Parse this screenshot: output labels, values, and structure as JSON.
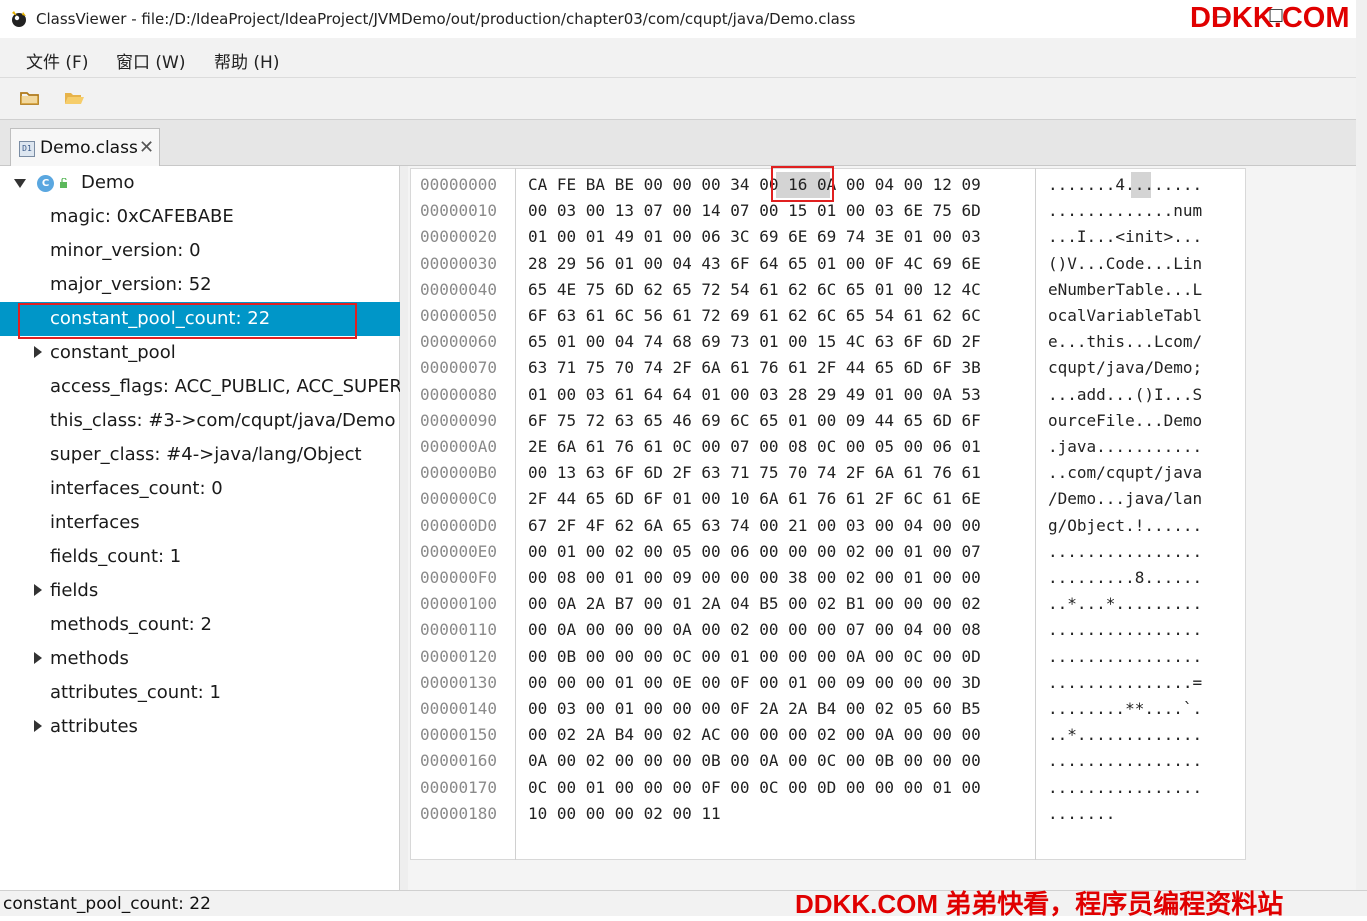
{
  "window": {
    "title": "ClassViewer - file:/D:/IdeaProject/IdeaProject/JVMDemo/out/production/chapter03/com/cqupt/java/Demo.class",
    "watermark_top": "DDKK.COM"
  },
  "menu": [
    {
      "label": "文件 (F)"
    },
    {
      "label": "窗口 (W)"
    },
    {
      "label": "帮助 (H)"
    }
  ],
  "toolbar": {
    "buttons": [
      {
        "icon": "folder-icon"
      },
      {
        "icon": "folder-open-icon"
      }
    ]
  },
  "tabs": [
    {
      "label": "Demo.class",
      "icon_text": "D1"
    }
  ],
  "tree": {
    "root": {
      "label": "Demo",
      "icon_letter": "C"
    },
    "items": [
      {
        "label": "magic: 0xCAFEBABE",
        "expandable": false
      },
      {
        "label": "minor_version: 0",
        "expandable": false
      },
      {
        "label": "major_version: 52",
        "expandable": false
      },
      {
        "label": "constant_pool_count: 22",
        "expandable": false,
        "selected": true
      },
      {
        "label": "constant_pool",
        "expandable": true
      },
      {
        "label": "access_flags: ACC_PUBLIC, ACC_SUPER",
        "expandable": false
      },
      {
        "label": "this_class: #3->com/cqupt/java/Demo",
        "expandable": false
      },
      {
        "label": "super_class: #4->java/lang/Object",
        "expandable": false
      },
      {
        "label": "interfaces_count: 0",
        "expandable": false
      },
      {
        "label": "interfaces",
        "expandable": false
      },
      {
        "label": "fields_count: 1",
        "expandable": false
      },
      {
        "label": "fields",
        "expandable": true
      },
      {
        "label": "methods_count: 2",
        "expandable": false
      },
      {
        "label": "methods",
        "expandable": true
      },
      {
        "label": "attributes_count: 1",
        "expandable": false
      },
      {
        "label": "attributes",
        "expandable": true
      }
    ]
  },
  "hex": {
    "rows": [
      {
        "offset": "00000000",
        "bytes": "CA FE BA BE 00 00 00 34 00 16 0A 00 04 00 12 09",
        "ascii": ".......4........"
      },
      {
        "offset": "00000010",
        "bytes": "00 03 00 13 07 00 14 07 00 15 01 00 03 6E 75 6D",
        "ascii": ".............num"
      },
      {
        "offset": "00000020",
        "bytes": "01 00 01 49 01 00 06 3C 69 6E 69 74 3E 01 00 03",
        "ascii": "...I...<init>..."
      },
      {
        "offset": "00000030",
        "bytes": "28 29 56 01 00 04 43 6F 64 65 01 00 0F 4C 69 6E",
        "ascii": "()V...Code...Lin"
      },
      {
        "offset": "00000040",
        "bytes": "65 4E 75 6D 62 65 72 54 61 62 6C 65 01 00 12 4C",
        "ascii": "eNumberTable...L"
      },
      {
        "offset": "00000050",
        "bytes": "6F 63 61 6C 56 61 72 69 61 62 6C 65 54 61 62 6C",
        "ascii": "ocalVariableTabl"
      },
      {
        "offset": "00000060",
        "bytes": "65 01 00 04 74 68 69 73 01 00 15 4C 63 6F 6D 2F",
        "ascii": "e...this...Lcom/"
      },
      {
        "offset": "00000070",
        "bytes": "63 71 75 70 74 2F 6A 61 76 61 2F 44 65 6D 6F 3B",
        "ascii": "cqupt/java/Demo;"
      },
      {
        "offset": "00000080",
        "bytes": "01 00 03 61 64 64 01 00 03 28 29 49 01 00 0A 53",
        "ascii": "...add...()I...S"
      },
      {
        "offset": "00000090",
        "bytes": "6F 75 72 63 65 46 69 6C 65 01 00 09 44 65 6D 6F",
        "ascii": "ourceFile...Demo"
      },
      {
        "offset": "000000A0",
        "bytes": "2E 6A 61 76 61 0C 00 07 00 08 0C 00 05 00 06 01",
        "ascii": ".java..........."
      },
      {
        "offset": "000000B0",
        "bytes": "00 13 63 6F 6D 2F 63 71 75 70 74 2F 6A 61 76 61",
        "ascii": "..com/cqupt/java"
      },
      {
        "offset": "000000C0",
        "bytes": "2F 44 65 6D 6F 01 00 10 6A 61 76 61 2F 6C 61 6E",
        "ascii": "/Demo...java/lan"
      },
      {
        "offset": "000000D0",
        "bytes": "67 2F 4F 62 6A 65 63 74 00 21 00 03 00 04 00 00",
        "ascii": "g/Object.!......"
      },
      {
        "offset": "000000E0",
        "bytes": "00 01 00 02 00 05 00 06 00 00 00 02 00 01 00 07",
        "ascii": "................"
      },
      {
        "offset": "000000F0",
        "bytes": "00 08 00 01 00 09 00 00 00 38 00 02 00 01 00 00",
        "ascii": ".........8......"
      },
      {
        "offset": "00000100",
        "bytes": "00 0A 2A B7 00 01 2A 04 B5 00 02 B1 00 00 00 02",
        "ascii": "..*...*........."
      },
      {
        "offset": "00000110",
        "bytes": "00 0A 00 00 00 0A 00 02 00 00 00 07 00 04 00 08",
        "ascii": "................"
      },
      {
        "offset": "00000120",
        "bytes": "00 0B 00 00 00 0C 00 01 00 00 00 0A 00 0C 00 0D",
        "ascii": "................"
      },
      {
        "offset": "00000130",
        "bytes": "00 00 00 01 00 0E 00 0F 00 01 00 09 00 00 00 3D",
        "ascii": "...............="
      },
      {
        "offset": "00000140",
        "bytes": "00 03 00 01 00 00 00 0F 2A 2A B4 00 02 05 60 B5",
        "ascii": "........**....`."
      },
      {
        "offset": "00000150",
        "bytes": "00 02 2A B4 00 02 AC 00 00 00 02 00 0A 00 00 00",
        "ascii": "..*............."
      },
      {
        "offset": "00000160",
        "bytes": "0A 00 02 00 00 00 0B 00 0A 00 0C 00 0B 00 00 00",
        "ascii": "................"
      },
      {
        "offset": "00000170",
        "bytes": "0C 00 01 00 00 00 0F 00 0C 00 0D 00 00 00 01 00",
        "ascii": "................"
      },
      {
        "offset": "00000180",
        "bytes": "10 00 00 00 02 00 11",
        "ascii": "......."
      }
    ]
  },
  "status": {
    "text": "constant_pool_count: 22",
    "watermark_bottom": "DDKK.COM 弟弟快看，程序员编程资料站"
  }
}
